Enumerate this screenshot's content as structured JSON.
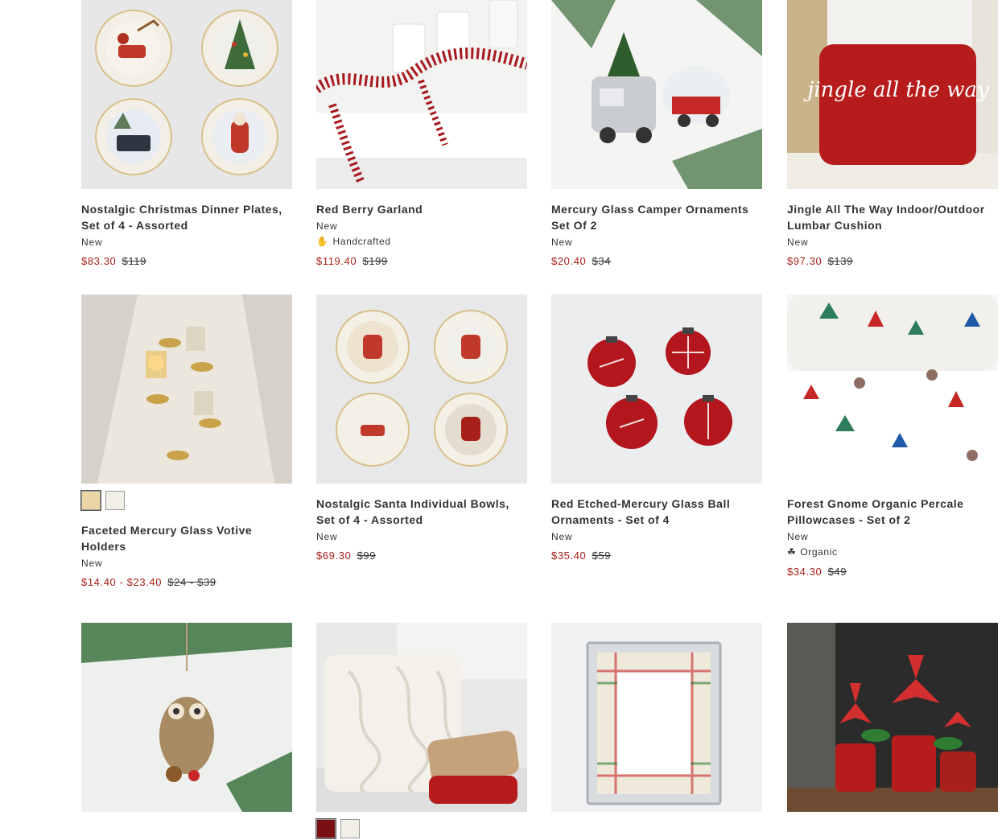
{
  "products": [
    {
      "title": "Nostalgic Christmas Dinner Plates, Set of 4 - Assorted",
      "badge": "New",
      "sale_price": "$83.30",
      "orig_price": "$119"
    },
    {
      "title": "Red Berry Garland",
      "badge": "New",
      "feature": "Handcrafted",
      "feature_icon": "hand-icon",
      "sale_price": "$119.40",
      "orig_price": "$199"
    },
    {
      "title": "Mercury Glass Camper Ornaments Set Of 2",
      "badge": "New",
      "sale_price": "$20.40",
      "orig_price": "$34"
    },
    {
      "title": "Jingle All The Way Indoor/Outdoor Lumbar Cushion",
      "badge": "New",
      "sale_price": "$97.30",
      "orig_price": "$139",
      "image_text": "jingle all the way"
    },
    {
      "title": "Faceted Mercury Glass Votive Holders",
      "badge": "New",
      "sale_price": "$14.40 - $23.40",
      "orig_price": "$24 - $39",
      "swatches": [
        "#e9d6a4",
        "#f2f0e6"
      ]
    },
    {
      "title": "Nostalgic Santa Individual Bowls, Set of 4 - Assorted",
      "badge": "New",
      "sale_price": "$69.30",
      "orig_price": "$99"
    },
    {
      "title": "Red Etched-Mercury Glass Ball Ornaments - Set of 4",
      "badge": "New",
      "sale_price": "$35.40",
      "orig_price": "$59"
    },
    {
      "title": "Forest Gnome Organic Percale Pillowcases - Set of 2",
      "badge": "New",
      "feature": "Organic",
      "feature_icon": "leaf-icon",
      "sale_price": "$34.30",
      "orig_price": "$49"
    },
    {
      "title": "",
      "swatches": []
    },
    {
      "title": "",
      "swatches": [
        "#7a0f14",
        "#f2f0e6"
      ]
    },
    {
      "title": ""
    },
    {
      "title": ""
    }
  ],
  "colors": {
    "sale": "#a8201a",
    "text": "#333333"
  }
}
